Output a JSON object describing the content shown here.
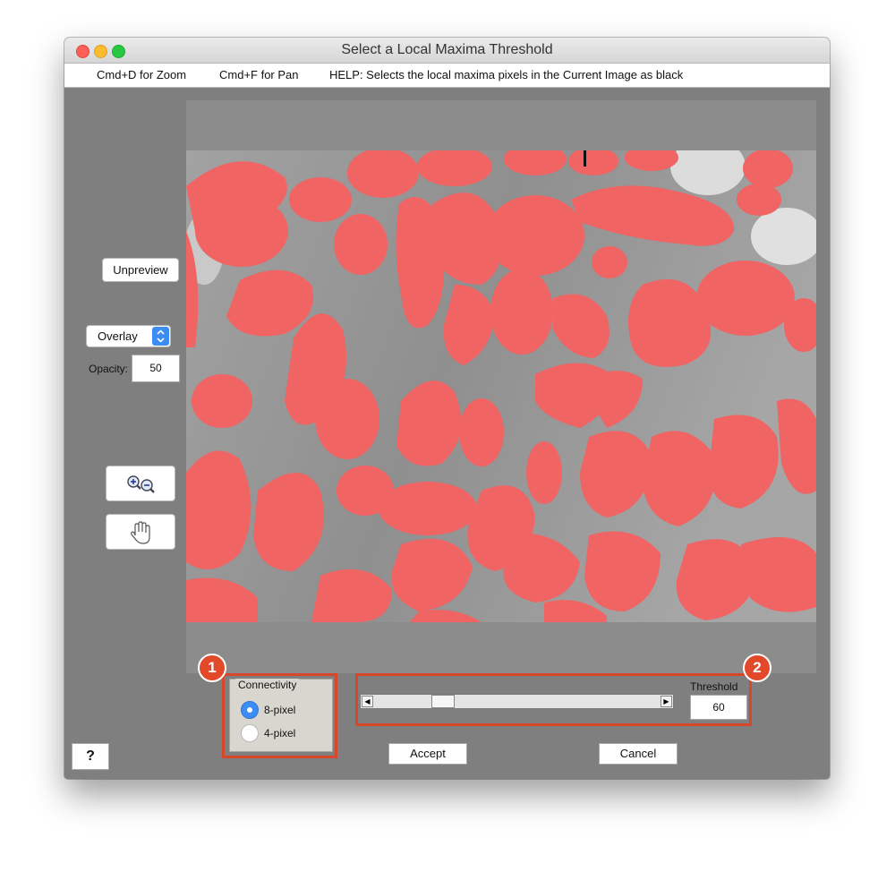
{
  "window": {
    "title": "Select a Local Maxima Threshold"
  },
  "menu": {
    "zoom_hint": "Cmd+D for Zoom",
    "pan_hint": "Cmd+F for Pan",
    "help_text": "HELP:  Selects the local maxima pixels in the Current Image as black"
  },
  "controls": {
    "unpreview_label": "Unpreview",
    "display_mode": "Overlay",
    "opacity_label": "Opacity:",
    "opacity_value": "50",
    "zoom_icons": [
      "zoom-in-icon",
      "zoom-out-icon"
    ],
    "pan_icon": "hand-icon"
  },
  "connectivity": {
    "legend": "Connectivity",
    "options": [
      {
        "label": "8-pixel",
        "selected": true
      },
      {
        "label": "4-pixel",
        "selected": false
      }
    ]
  },
  "threshold": {
    "label": "Threshold",
    "value": "60",
    "slider_position": 0.22
  },
  "buttons": {
    "help": "?",
    "accept": "Accept",
    "cancel": "Cancel"
  },
  "callouts": {
    "one": "1",
    "two": "2"
  },
  "colors": {
    "overlay": "#f06464",
    "highlight": "#d9472b",
    "radio_selected": "#3b8cf3"
  }
}
